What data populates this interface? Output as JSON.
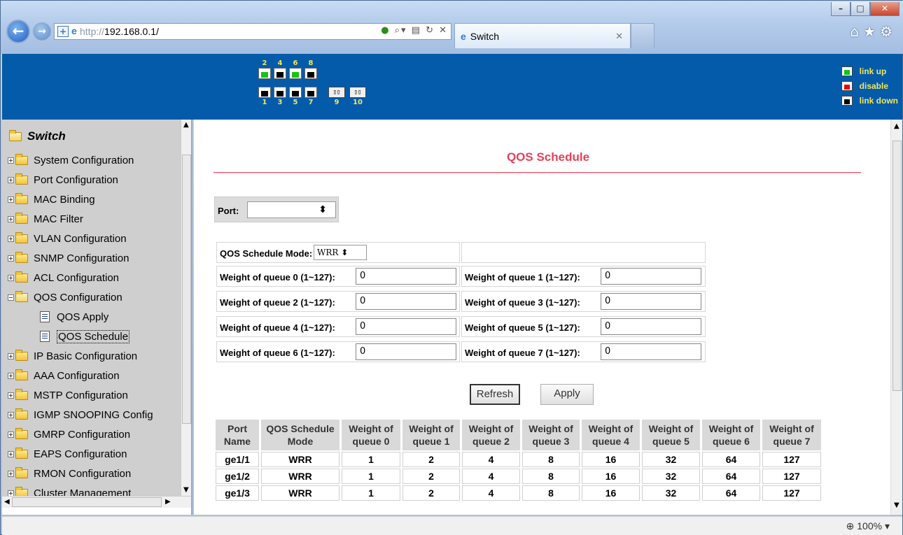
{
  "browser": {
    "url_prefix": "http://",
    "url_host": "192.168.0.1/",
    "tab_title": "Switch",
    "zoom": "100%"
  },
  "ports": {
    "top_numbers": [
      "2",
      "4",
      "6",
      "8"
    ],
    "bottom_numbers": [
      "1",
      "3",
      "5",
      "7"
    ],
    "fiber_numbers": [
      "9",
      "10"
    ],
    "top_status": [
      "up",
      "down",
      "up",
      "down"
    ],
    "bottom_status": [
      "down",
      "down",
      "down",
      "down"
    ],
    "legend": {
      "up": "link up",
      "disable": "disable",
      "down": "link down"
    }
  },
  "tree": {
    "root": "Switch",
    "items": [
      "System Configuration",
      "Port Configuration",
      "MAC Binding",
      "MAC Filter",
      "VLAN Configuration",
      "SNMP Configuration",
      "ACL Configuration",
      "QOS Configuration",
      "QOS Apply",
      "QOS Schedule",
      "IP Basic Configuration",
      "AAA Configuration",
      "MSTP Configuration",
      "IGMP SNOOPING Config",
      "GMRP Configuration",
      "EAPS Configuration",
      "RMON Configuration",
      "Cluster Management"
    ]
  },
  "page": {
    "title": "QOS Schedule",
    "port_label": "Port:",
    "port_value": "",
    "mode_label": "QOS Schedule Mode:",
    "mode_value": "WRR",
    "weights": [
      {
        "label": "Weight of queue 0 (1~127):",
        "value": "0"
      },
      {
        "label": "Weight of queue 1 (1~127):",
        "value": "0"
      },
      {
        "label": "Weight of queue 2 (1~127):",
        "value": "0"
      },
      {
        "label": "Weight of queue 3 (1~127):",
        "value": "0"
      },
      {
        "label": "Weight of queue 4 (1~127):",
        "value": "0"
      },
      {
        "label": "Weight of queue 5 (1~127):",
        "value": "0"
      },
      {
        "label": "Weight of queue 6 (1~127):",
        "value": "0"
      },
      {
        "label": "Weight of queue 7 (1~127):",
        "value": "0"
      }
    ],
    "refresh_label": "Refresh",
    "apply_label": "Apply"
  },
  "table": {
    "headers": [
      [
        "Port",
        "Name"
      ],
      [
        "QOS Schedule",
        "Mode"
      ],
      [
        "Weight of",
        "queue 0"
      ],
      [
        "Weight of",
        "queue 1"
      ],
      [
        "Weight of",
        "queue 2"
      ],
      [
        "Weight of",
        "queue 3"
      ],
      [
        "Weight of",
        "queue 4"
      ],
      [
        "Weight of",
        "queue 5"
      ],
      [
        "Weight of",
        "queue 6"
      ],
      [
        "Weight of",
        "queue 7"
      ]
    ],
    "rows": [
      [
        "ge1/1",
        "WRR",
        "1",
        "2",
        "4",
        "8",
        "16",
        "32",
        "64",
        "127"
      ],
      [
        "ge1/2",
        "WRR",
        "1",
        "2",
        "4",
        "8",
        "16",
        "32",
        "64",
        "127"
      ],
      [
        "ge1/3",
        "WRR",
        "1",
        "2",
        "4",
        "8",
        "16",
        "32",
        "64",
        "127"
      ]
    ]
  }
}
